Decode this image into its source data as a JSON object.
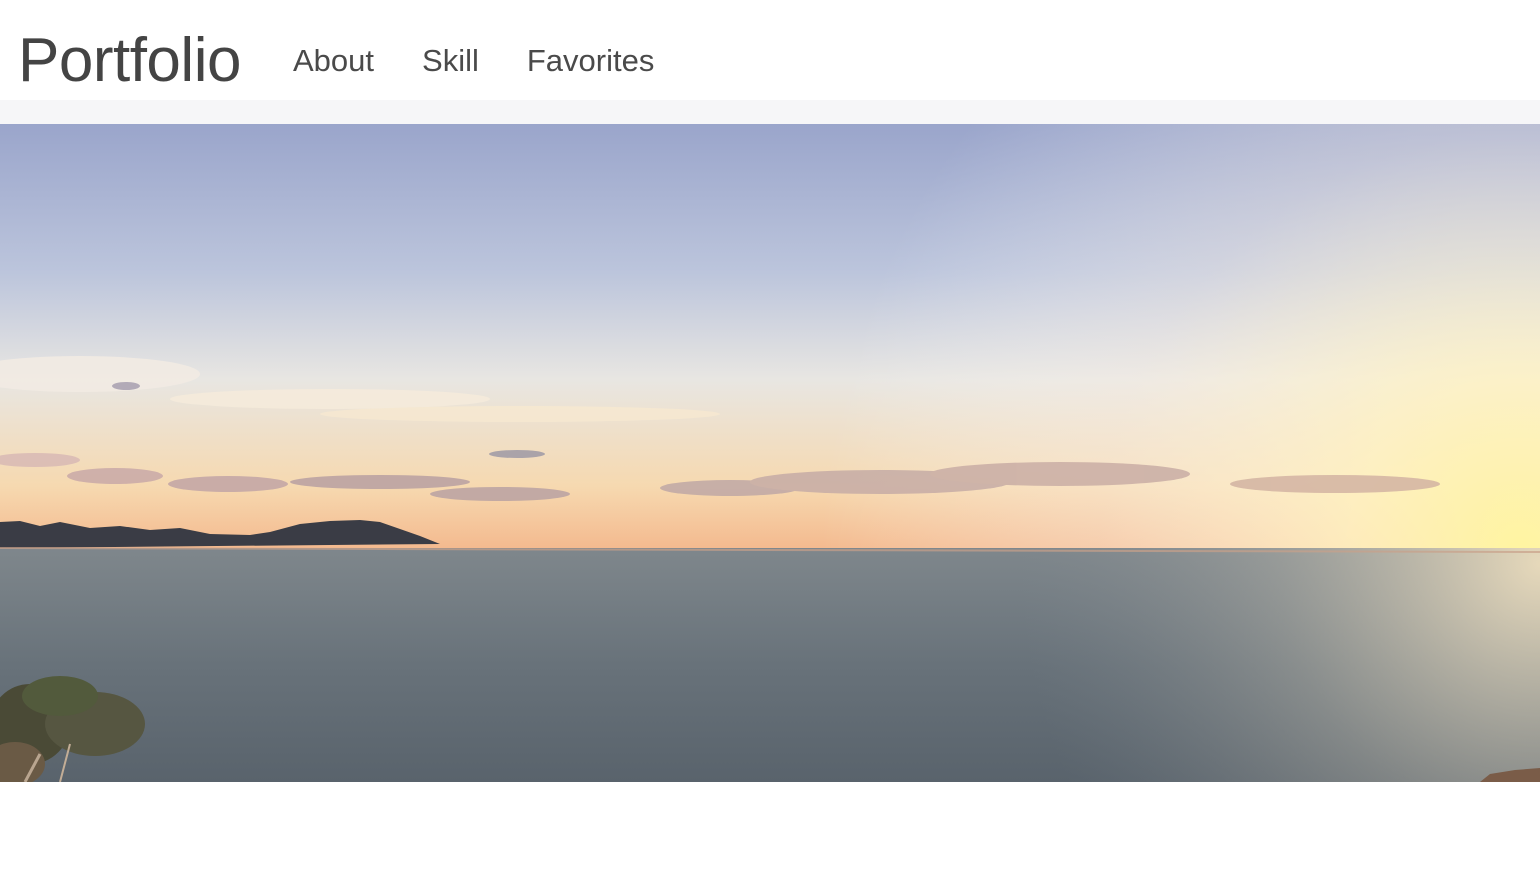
{
  "navbar": {
    "brand": "Portfolio",
    "links": [
      {
        "label": "About"
      },
      {
        "label": "Skill"
      },
      {
        "label": "Favorites"
      }
    ]
  },
  "hero": {
    "image": "sunset-over-sea-photo"
  },
  "colors": {
    "text": "#4a4a4a",
    "strip": "#f6f6f8",
    "sky_top": "#9ea8cc",
    "sun_glow": "#fff2a8",
    "sea": "#6f777c"
  }
}
